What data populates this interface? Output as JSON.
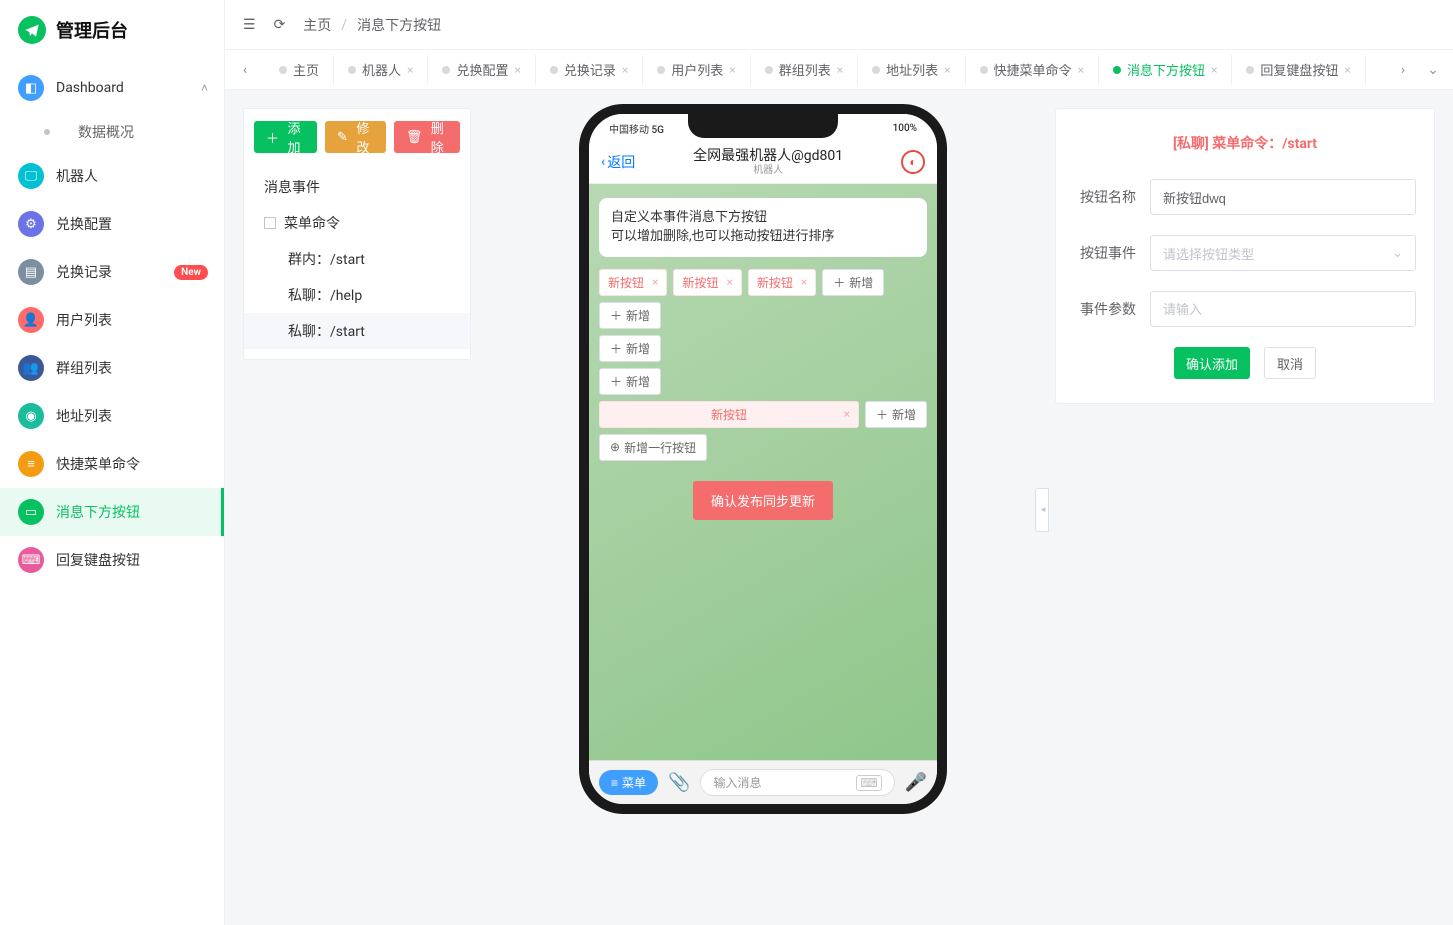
{
  "app": {
    "title": "管理后台"
  },
  "sidebar": {
    "items": [
      {
        "label": "Dashboard",
        "icon_bg": "bg-blue",
        "glyph": "📄",
        "expanded": true
      },
      {
        "label": "数据概况"
      },
      {
        "label": "机器人",
        "icon_bg": "bg-teal",
        "glyph": "🖵"
      },
      {
        "label": "兑换配置",
        "icon_bg": "bg-indigo",
        "glyph": "⚙"
      },
      {
        "label": "兑换记录",
        "icon_bg": "bg-slate",
        "glyph": "📋",
        "badge": "New"
      },
      {
        "label": "用户列表",
        "icon_bg": "bg-red",
        "glyph": "👤"
      },
      {
        "label": "群组列表",
        "icon_bg": "bg-navy",
        "glyph": "👥"
      },
      {
        "label": "地址列表",
        "icon_bg": "bg-green",
        "glyph": "📍"
      },
      {
        "label": "快捷菜单命令",
        "icon_bg": "bg-orange",
        "glyph": "≡"
      },
      {
        "label": "消息下方按钮",
        "icon_bg": "bg-green2",
        "glyph": "▭"
      },
      {
        "label": "回复键盘按钮",
        "icon_bg": "bg-pink",
        "glyph": "⌨"
      }
    ]
  },
  "topbar": {
    "home": "主页",
    "current": "消息下方按钮"
  },
  "tabs": [
    {
      "label": "主页"
    },
    {
      "label": "机器人"
    },
    {
      "label": "兑换配置"
    },
    {
      "label": "兑换记录"
    },
    {
      "label": "用户列表"
    },
    {
      "label": "群组列表"
    },
    {
      "label": "地址列表"
    },
    {
      "label": "快捷菜单命令"
    },
    {
      "label": "消息下方按钮",
      "active": true
    },
    {
      "label": "回复键盘按钮"
    }
  ],
  "toolbar": {
    "add": "添加",
    "edit": "修改",
    "del": "删除"
  },
  "tree": {
    "root": "消息事件",
    "group": "菜单命令",
    "children": [
      {
        "label": "群内：/start"
      },
      {
        "label": "私聊：/help"
      },
      {
        "label": "私聊：/start",
        "selected": true
      }
    ]
  },
  "phone": {
    "status_left": "中国移动 5G",
    "status_right": "100%",
    "back": "返回",
    "title": "全网最强机器人@gd801",
    "subtitle": "机器人",
    "bubble_l1": "自定义本事件消息下方按钮",
    "bubble_l2": "可以增加删除,也可以拖动按钮进行排序",
    "chip": "新按钮",
    "add": "新增",
    "addrow": "新增一行按钮",
    "publish": "确认发布同步更新",
    "menu": "菜单",
    "input_ph": "输入消息"
  },
  "form": {
    "title": "[私聊]   菜单命令：/start",
    "label_name": "按钮名称",
    "value_name": "新按钮dwq",
    "label_event": "按钮事件",
    "placeholder_event": "请选择按钮类型",
    "label_param": "事件参数",
    "placeholder_param": "请输入",
    "confirm": "确认添加",
    "cancel": "取消"
  }
}
